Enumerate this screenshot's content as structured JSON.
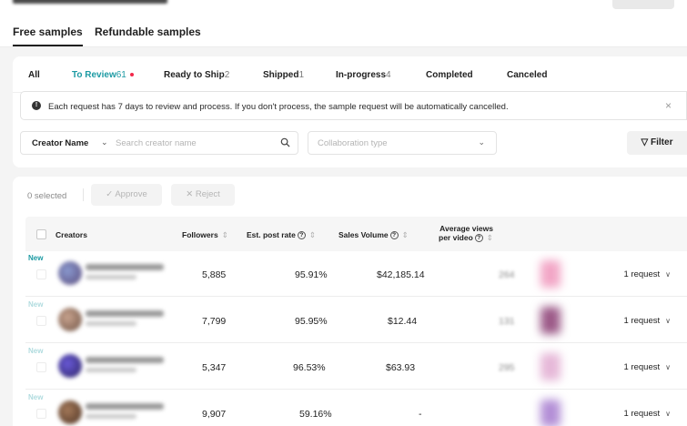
{
  "main_tabs": [
    {
      "label": "Free samples",
      "active": true
    },
    {
      "label": "Refundable samples",
      "active": false
    }
  ],
  "status_tabs": [
    {
      "label": "All",
      "count": ""
    },
    {
      "label": "To Review",
      "count": "61"
    },
    {
      "label": "Ready to Ship",
      "count": "2"
    },
    {
      "label": "Shipped",
      "count": "1"
    },
    {
      "label": "In-progress",
      "count": "4"
    },
    {
      "label": "Completed",
      "count": ""
    },
    {
      "label": "Canceled",
      "count": ""
    }
  ],
  "notice": {
    "text": "Each request has 7 days to review and process. If you don't process, the sample request will be automatically cancelled.",
    "close": "×"
  },
  "filters": {
    "search_type": "Creator Name",
    "search_placeholder": "Search creator name",
    "collab_placeholder": "Collaboration type",
    "filter_label": "Filter"
  },
  "bulk_actions": {
    "selected": "0 selected",
    "approve": "Approve",
    "reject": "Reject"
  },
  "table": {
    "headers": {
      "creators": "Creators",
      "followers": "Followers",
      "post_rate": "Est. post rate",
      "sales": "Sales Volume",
      "avg_views_line1": "Average views",
      "avg_views_line2": "per video"
    },
    "rows": [
      {
        "badge": "New",
        "followers": "5,885",
        "post_rate": "95.91%",
        "sales": "$42,185.14",
        "views": "264",
        "request": "1 request"
      },
      {
        "badge": "New",
        "followers": "7,799",
        "post_rate": "95.95%",
        "sales": "$12.44",
        "views": "131",
        "request": "1 request"
      },
      {
        "badge": "New",
        "followers": "5,347",
        "post_rate": "96.53%",
        "sales": "$63.93",
        "views": "295",
        "request": "1 request"
      },
      {
        "badge": "New",
        "followers": "9,907",
        "post_rate": "59.16%",
        "sales": "-",
        "views": "",
        "request": "1 request"
      }
    ]
  },
  "colors": {
    "accent": "#1c9aa3",
    "dot": "#f2274a"
  }
}
